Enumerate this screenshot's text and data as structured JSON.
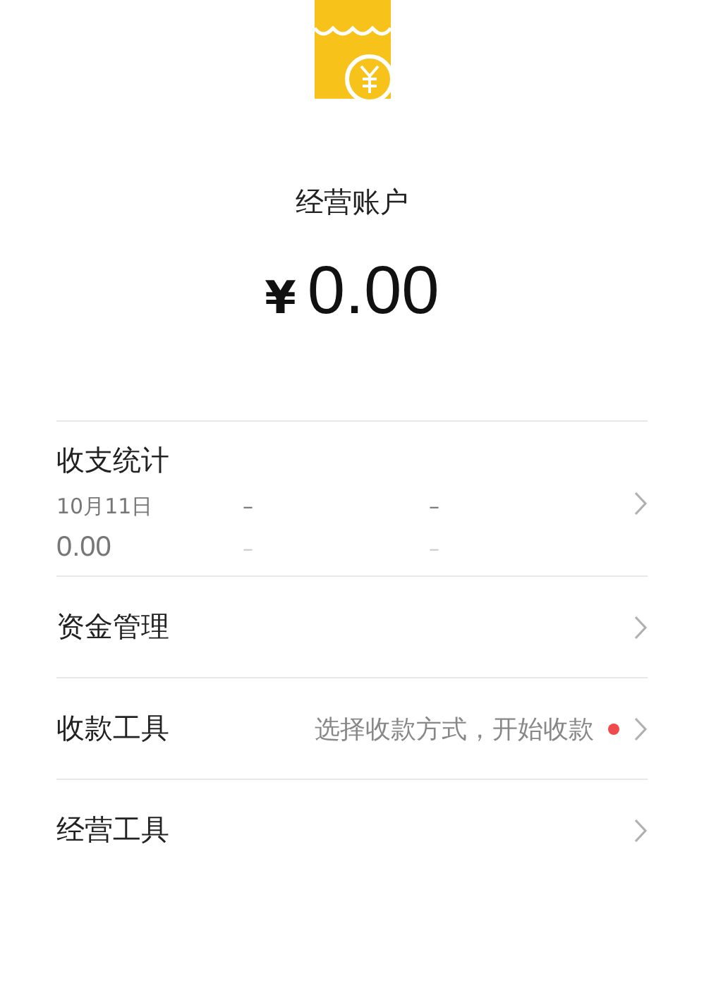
{
  "account": {
    "title": "经营账户",
    "currency": "¥",
    "amount": "0.00"
  },
  "stats": {
    "title": "收支统计",
    "date": "10月11日",
    "value": "0.00",
    "columns": [
      {
        "top": "–",
        "bottom": "–"
      },
      {
        "top": "–",
        "bottom": "–"
      }
    ]
  },
  "menu": [
    {
      "label": "资金管理",
      "hint_dot": false
    },
    {
      "label": "收款工具",
      "hint": "选择收款方式，开始收款",
      "hint_dot": true
    },
    {
      "label": "经营工具",
      "hint_dot": false
    }
  ]
}
